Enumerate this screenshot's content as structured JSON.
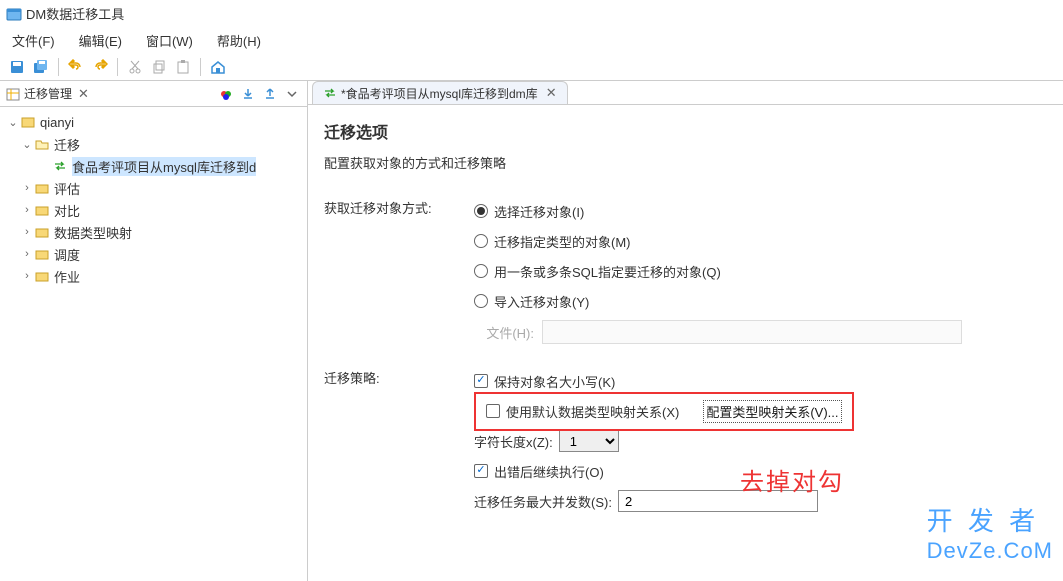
{
  "app": {
    "title": "DM数据迁移工具"
  },
  "menubar": {
    "file": "文件(F)",
    "edit": "编辑(E)",
    "window": "窗口(W)",
    "help": "帮助(H)"
  },
  "toolbar_icons": {
    "save": "save-icon",
    "save_all": "save-all-icon",
    "undo": "undo-icon",
    "redo": "redo-icon",
    "cut": "cut-icon",
    "copy": "copy-icon",
    "paste": "paste-icon",
    "home": "home-icon"
  },
  "sidepanel": {
    "tab_title": "迁移管理",
    "tree": {
      "root": "qianyi",
      "items": [
        {
          "label": "迁移",
          "expanded": true,
          "children": [
            {
              "label": "食品考评项目从mysql库迁移到d"
            }
          ]
        },
        {
          "label": "评估"
        },
        {
          "label": "对比"
        },
        {
          "label": "数据类型映射"
        },
        {
          "label": "调度"
        },
        {
          "label": "作业"
        }
      ]
    }
  },
  "editor": {
    "tab": "*食品考评项目从mysql库迁移到dm库",
    "heading": "迁移选项",
    "subheading": "配置获取对象的方式和迁移策略",
    "mode_label": "获取迁移对象方式:",
    "modes": {
      "select_objects": "选择迁移对象(I)",
      "by_type": "迁移指定类型的对象(M)",
      "by_sql": "用一条或多条SQL指定要迁移的对象(Q)",
      "import": "导入迁移对象(Y)"
    },
    "file_label": "文件(H):",
    "strategy_label": "迁移策略:",
    "strategy": {
      "keep_case": "保持对象名大小写(K)",
      "use_default_map": "使用默认数据类型映射关系(X)",
      "config_map_btn": "配置类型映射关系(V)...",
      "char_len_label": "字符长度x(Z):",
      "char_len_value": "1",
      "continue_on_err": "出错后继续执行(O)",
      "max_concurrency_label": "迁移任务最大并发数(S):",
      "max_concurrency_value": "2"
    }
  },
  "annotation": "去掉对勾",
  "watermark": {
    "line1": "开 发 者",
    "line2": "DevZe.CoM"
  }
}
